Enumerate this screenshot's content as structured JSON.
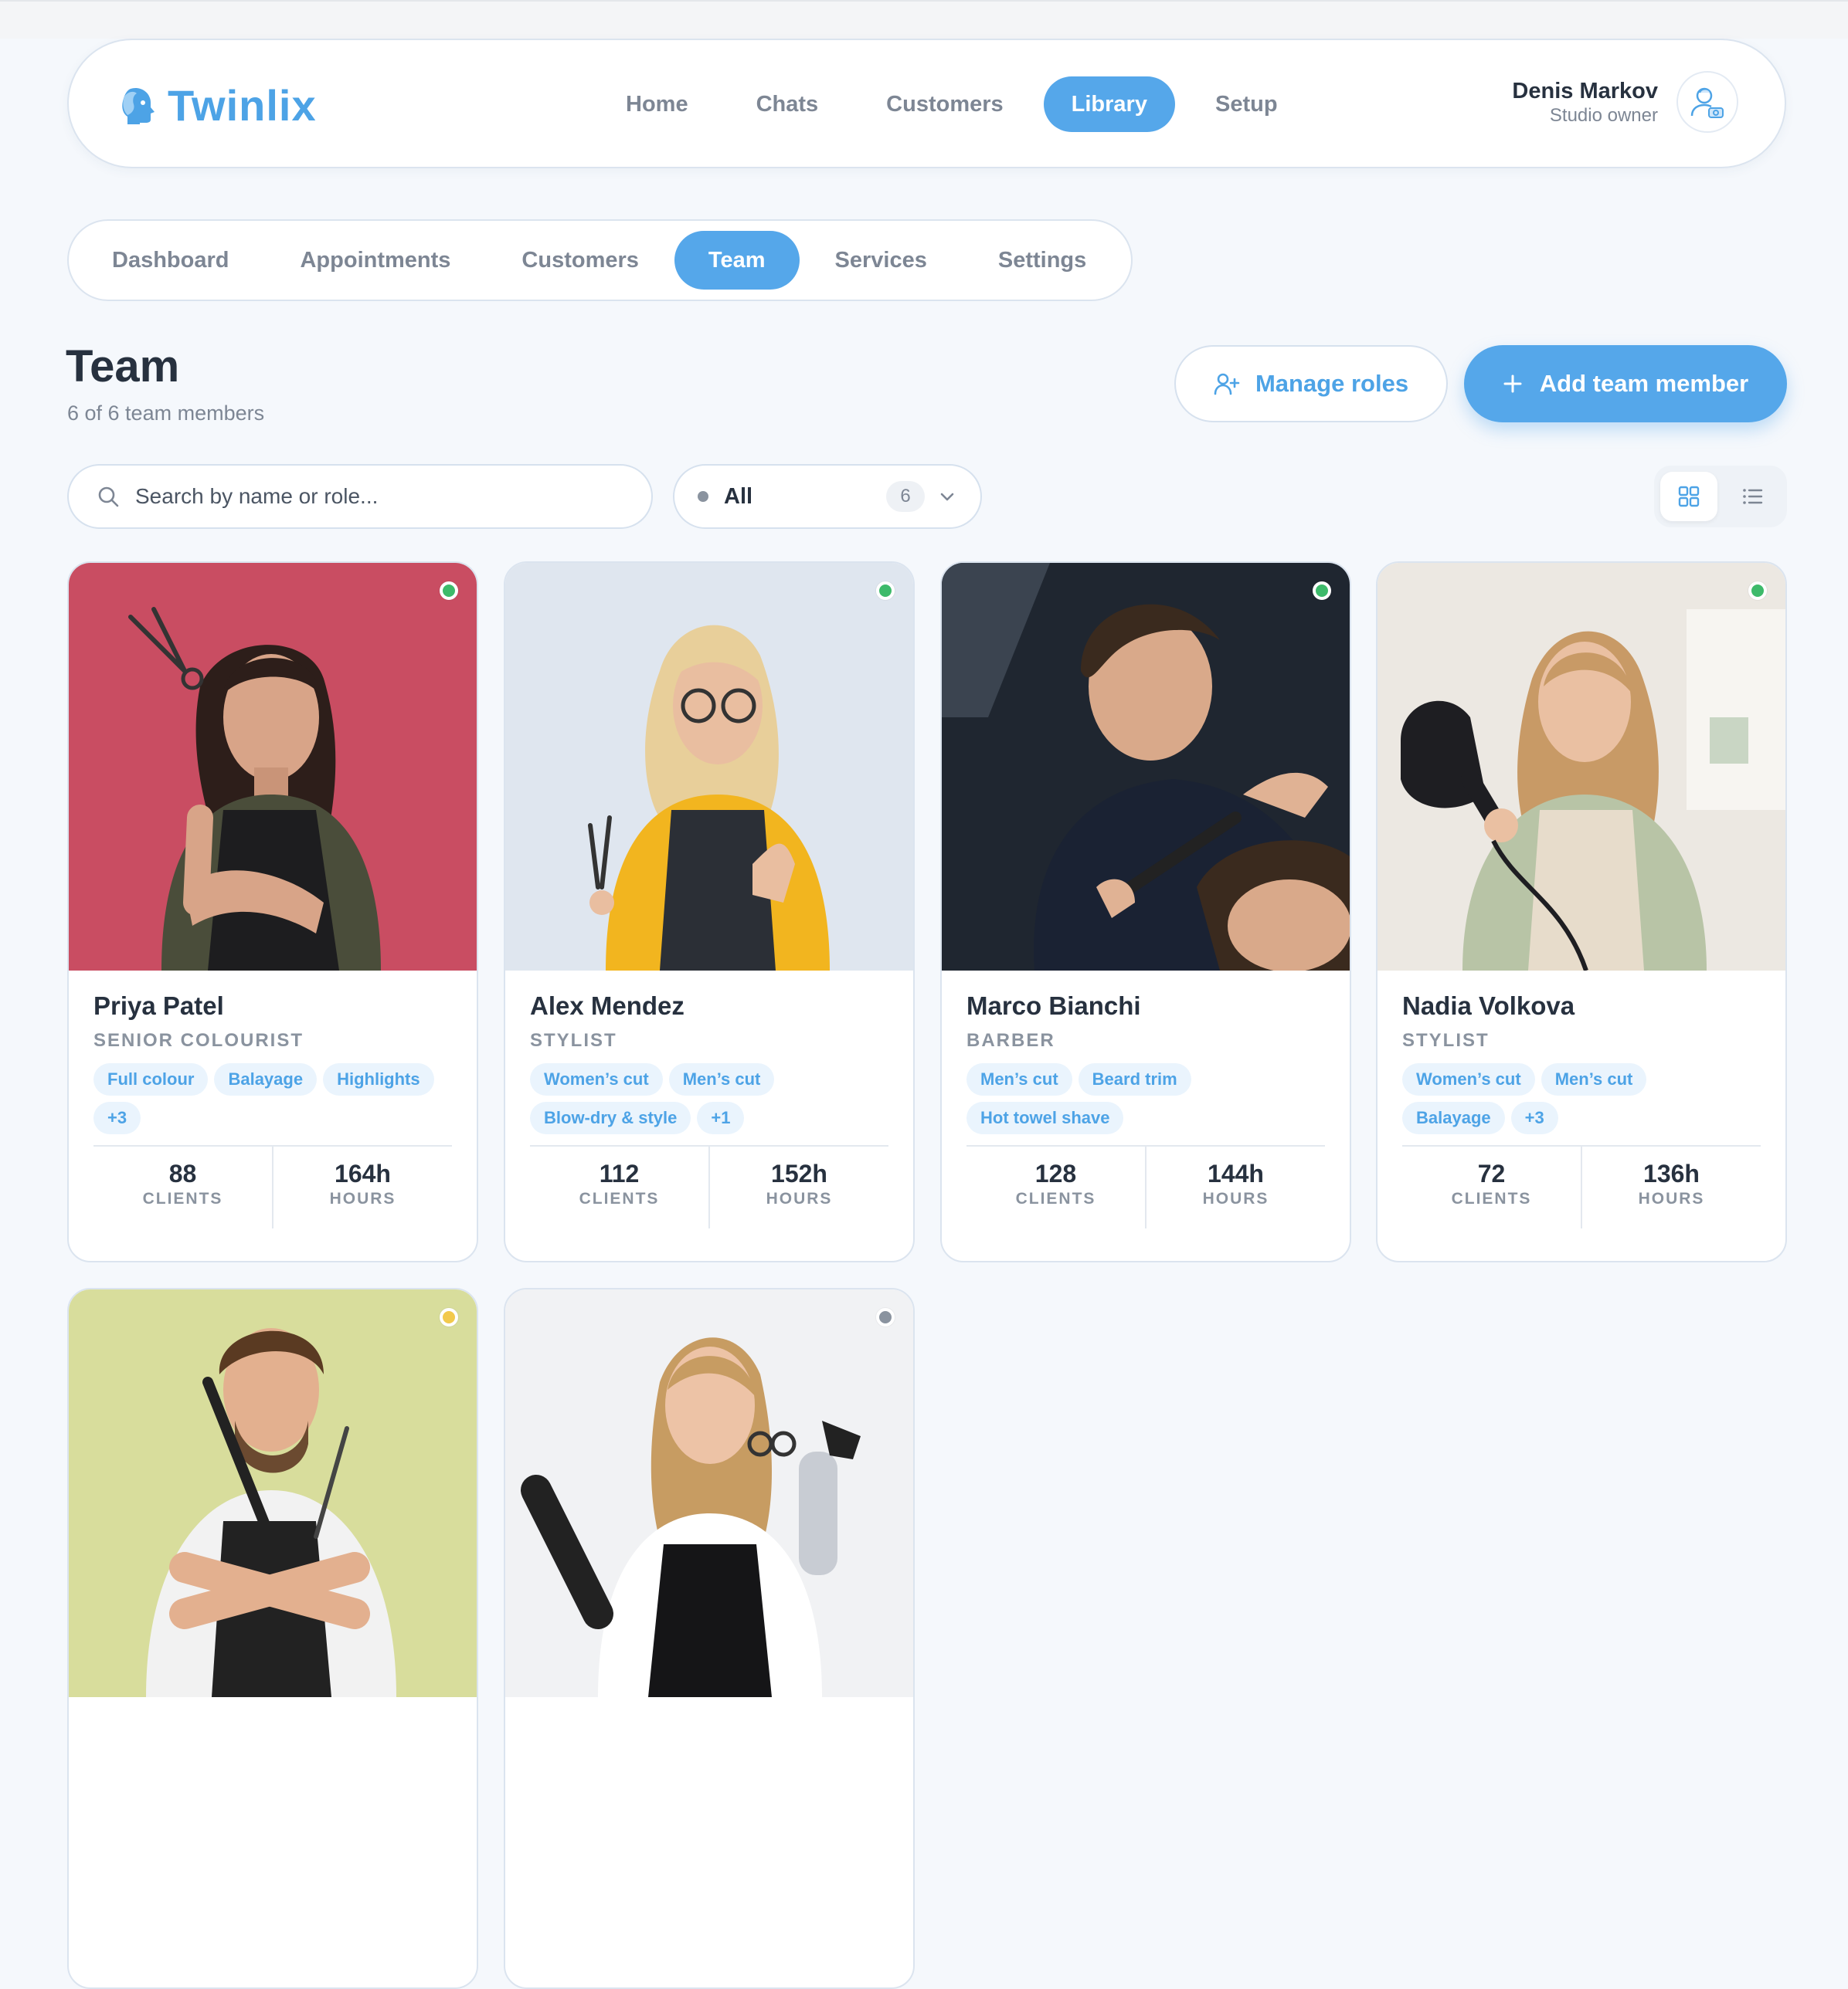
{
  "brand": {
    "name": "Twinlix",
    "color": "#4da3e6"
  },
  "main_nav": [
    {
      "label": "Home",
      "active": false
    },
    {
      "label": "Chats",
      "active": false
    },
    {
      "label": "Customers",
      "active": false
    },
    {
      "label": "Library",
      "active": true
    },
    {
      "label": "Setup",
      "active": false
    }
  ],
  "user": {
    "name": "Denis Markov",
    "role": "Studio owner",
    "icon": "user-avatar-icon"
  },
  "sub_nav": [
    {
      "label": "Dashboard",
      "active": false
    },
    {
      "label": "Appointments",
      "active": false
    },
    {
      "label": "Customers",
      "active": false
    },
    {
      "label": "Team",
      "active": true
    },
    {
      "label": "Services",
      "active": false
    },
    {
      "label": "Settings",
      "active": false
    }
  ],
  "page": {
    "title": "Team",
    "subtitle": "6 of 6 team members"
  },
  "actions": {
    "manage_roles": "Manage roles",
    "add_member": "Add team member"
  },
  "search": {
    "placeholder": "Search by name or role...",
    "value": ""
  },
  "filter": {
    "label": "All",
    "count": "6"
  },
  "view": {
    "active": "grid"
  },
  "colors": {
    "accent": "#55a7ea",
    "online": "#3dba6a",
    "away": "#f2c94c",
    "offline": "#8a939f"
  },
  "members": [
    {
      "name": "Priya Patel",
      "role": "SENIOR COLOURIST",
      "tags": [
        "Full colour",
        "Balayage",
        "Highlights",
        "+3"
      ],
      "clients": "88",
      "clients_label": "CLIENTS",
      "hours": "164h",
      "hours_label": "HOURS",
      "status": "online"
    },
    {
      "name": "Alex Mendez",
      "role": "STYLIST",
      "tags": [
        "Women’s cut",
        "Men’s cut",
        "Blow-dry & style",
        "+1"
      ],
      "clients": "112",
      "clients_label": "CLIENTS",
      "hours": "152h",
      "hours_label": "HOURS",
      "status": "online"
    },
    {
      "name": "Marco Bianchi",
      "role": "BARBER",
      "tags": [
        "Men’s cut",
        "Beard trim",
        "Hot towel shave"
      ],
      "clients": "128",
      "clients_label": "CLIENTS",
      "hours": "144h",
      "hours_label": "HOURS",
      "status": "online"
    },
    {
      "name": "Nadia Volkova",
      "role": "STYLIST",
      "tags": [
        "Women’s cut",
        "Men’s cut",
        "Balayage",
        "+3"
      ],
      "clients": "72",
      "clients_label": "CLIENTS",
      "hours": "136h",
      "hours_label": "HOURS",
      "status": "online"
    },
    {
      "status": "away"
    },
    {
      "status": "offline"
    }
  ]
}
